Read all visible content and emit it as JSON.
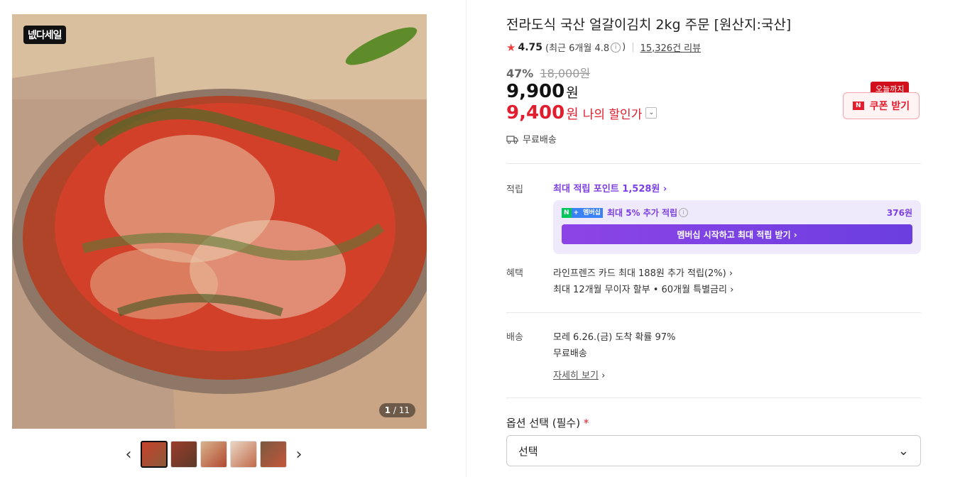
{
  "gallery": {
    "badge": "넶다세일",
    "counter_current": "1",
    "counter_total": "/ 11",
    "prev_arrow": "‹",
    "next_arrow": "›",
    "thumbnail_count": 5
  },
  "product": {
    "title": "전라도식 국산 얼갈이김치 2kg 주문 [원산지:국산]",
    "rating": "4.75",
    "rating_recent": "(최근 6개월 4.8",
    "rating_close": ")",
    "review_count": "15,326건 리뷰",
    "discount_rate": "47%",
    "original_price": "18,000원",
    "price": "9,900",
    "price_unit": "원",
    "my_price": "9,400",
    "my_price_unit": "원",
    "my_price_label": "나의 할인가",
    "coupon_tag": "오늘까지",
    "coupon_label": "쿠폰 받기",
    "free_shipping": "무료배송"
  },
  "points": {
    "label": "적립",
    "max_points": "최대 적립 포인트 1,528원",
    "membership_badge": "멤버십",
    "membership_text": "최대 5% 추가 적립",
    "membership_amount": "376원",
    "membership_button": "멤버십 시작하고 최대 적립 받기 ›"
  },
  "benefits": {
    "label": "혜택",
    "card": "라인프렌즈 카드 최대 188원 추가 적립(2%)",
    "installment": "최대 12개월 무이자 할부 • 60개월 특별금리"
  },
  "delivery": {
    "label": "배송",
    "arrival": "모레 6.26.(금) 도착 확률 97%",
    "fee": "무료배송",
    "detail_link": "자세히 보기"
  },
  "options": {
    "label": "옵션 선택 (필수)",
    "required_mark": "*",
    "select_value": "선택"
  },
  "colors": {
    "accent_red": "#e11d2e",
    "membership_purple": "#7b3fe4"
  }
}
